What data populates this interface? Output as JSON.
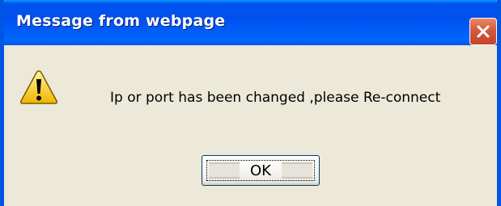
{
  "window": {
    "title": "Message from webpage"
  },
  "dialog": {
    "icon": "warning-icon",
    "message": "Ip or port has been changed ,please Re-connect",
    "ok_label": "OK"
  },
  "colors": {
    "titlebar": "#0054e3",
    "close_button": "#d35a3a",
    "dialog_background": "#ece9d8",
    "warning_yellow": "#ffd500"
  }
}
